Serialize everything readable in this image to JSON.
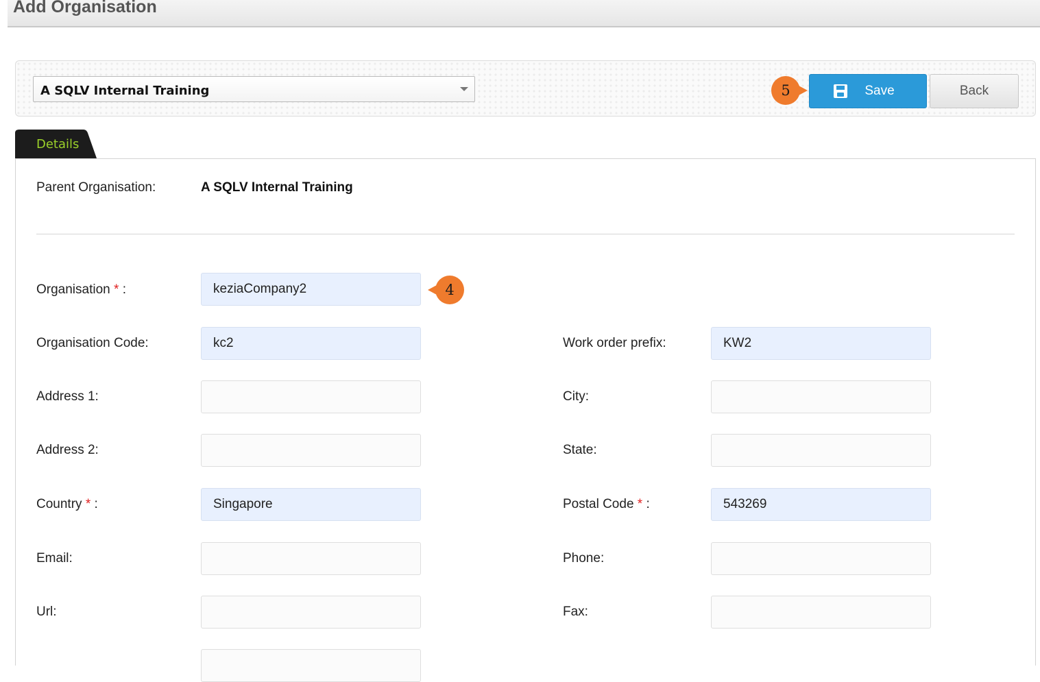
{
  "page_title": "Add Organisation",
  "toolbar": {
    "org_select_value": "A SQLV Internal Training",
    "save_label": "Save",
    "back_label": "Back"
  },
  "callouts": {
    "step_save": "5",
    "step_org": "4"
  },
  "tabs": [
    {
      "label": "Details",
      "active": true
    }
  ],
  "details": {
    "parent_label": "Parent Organisation:",
    "parent_value": "A SQLV Internal Training",
    "fields": {
      "organisation": {
        "label": "Organisation",
        "required": "*",
        "suffix": ":",
        "value": "keziaCompany2"
      },
      "organisation_code": {
        "label": "Organisation Code:",
        "value": "kc2"
      },
      "work_order_prefix": {
        "label": "Work order prefix:",
        "value": "KW2"
      },
      "address1": {
        "label": "Address 1:",
        "value": ""
      },
      "city": {
        "label": "City:",
        "value": ""
      },
      "address2": {
        "label": "Address 2:",
        "value": ""
      },
      "state": {
        "label": "State:",
        "value": ""
      },
      "country": {
        "label": "Country",
        "required": "*",
        "suffix": ":",
        "value": "Singapore"
      },
      "postal_code": {
        "label": "Postal Code",
        "required": "*",
        "suffix": ":",
        "value": "543269"
      },
      "email": {
        "label": "Email:",
        "value": ""
      },
      "phone": {
        "label": "Phone:",
        "value": ""
      },
      "url": {
        "label": "Url:",
        "value": ""
      },
      "fax": {
        "label": "Fax:",
        "value": ""
      },
      "next": {
        "value": ""
      }
    }
  },
  "colors": {
    "save_button": "#2b9ad9",
    "callout": "#ef7b2d",
    "tab_background": "#1c1c1c",
    "tab_text": "#9bd12a",
    "filled_field": "#e8f0fe",
    "required_marker": "#e02020"
  }
}
